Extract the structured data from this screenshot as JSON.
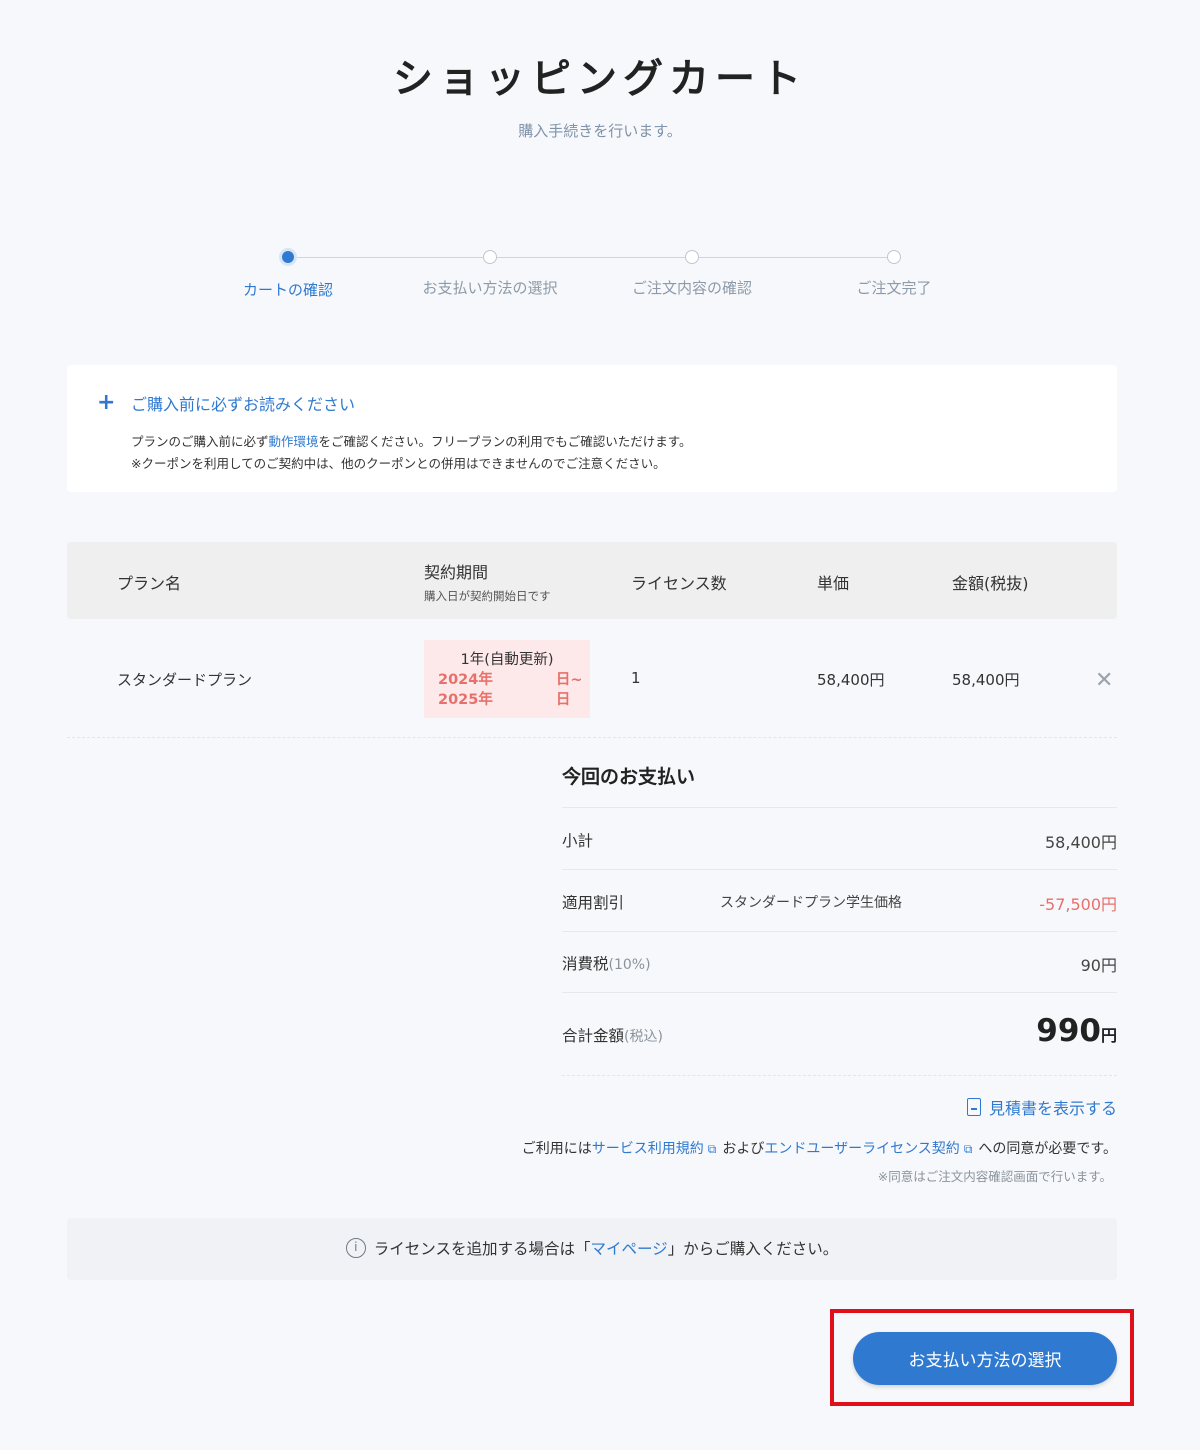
{
  "header": {
    "title": "ショッピングカート",
    "subtitle": "購入手続きを行います。"
  },
  "steps": [
    {
      "label": "カートの確認",
      "active": true
    },
    {
      "label": "お支払い方法の選択",
      "active": false
    },
    {
      "label": "ご注文内容の確認",
      "active": false
    },
    {
      "label": "ご注文完了",
      "active": false
    }
  ],
  "notice": {
    "title": "ご購入前に必ずお読みください",
    "line1_prefix": "プランのご購入前に必ず",
    "line1_link": "動作環境",
    "line1_suffix": "をご確認ください。フリープランの利用でもご確認いただけます。",
    "line2": "※クーポンを利用してのご契約中は、他のクーポンとの併用はできませんのでご注意ください。"
  },
  "table": {
    "headers": {
      "plan": "プラン名",
      "period": "契約期間",
      "period_sub": "購入日が契約開始日です",
      "licenses": "ライセンス数",
      "unit_price": "単価",
      "amount": "金額(税抜)"
    },
    "rows": [
      {
        "plan": "スタンダードプラン",
        "period_main": "1年(自動更新)",
        "period_start": "2024年 　　　　日~",
        "period_end": "2025年 　　　　日",
        "licenses": "1",
        "unit_price": "58,400円",
        "amount": "58,400円"
      }
    ]
  },
  "summary": {
    "title": "今回のお支払い",
    "subtotal_label": "小計",
    "subtotal_value": "58,400円",
    "discount_label": "適用割引",
    "discount_name": "スタンダードプラン学生価格",
    "discount_value": "-57,500円",
    "tax_label": "消費税",
    "tax_note": "(10%)",
    "tax_value": "90円",
    "total_label": "合計金額",
    "total_note": "(税込)",
    "total_value": "990",
    "total_unit": "円"
  },
  "links": {
    "estimate": "見積書を表示する",
    "terms_prefix": "ご利用には",
    "terms_link1": "サービス利用規約",
    "terms_mid": "および",
    "terms_link2": "エンドユーザーライセンス契約",
    "terms_suffix": "への同意が必要です。",
    "terms_note": "※同意はご注文内容確認画面で行います。"
  },
  "info": {
    "prefix": "ライセンスを追加する場合は「",
    "link": "マイページ",
    "suffix": "」からご購入ください。"
  },
  "actions": {
    "next_label": "お支払い方法の選択"
  }
}
